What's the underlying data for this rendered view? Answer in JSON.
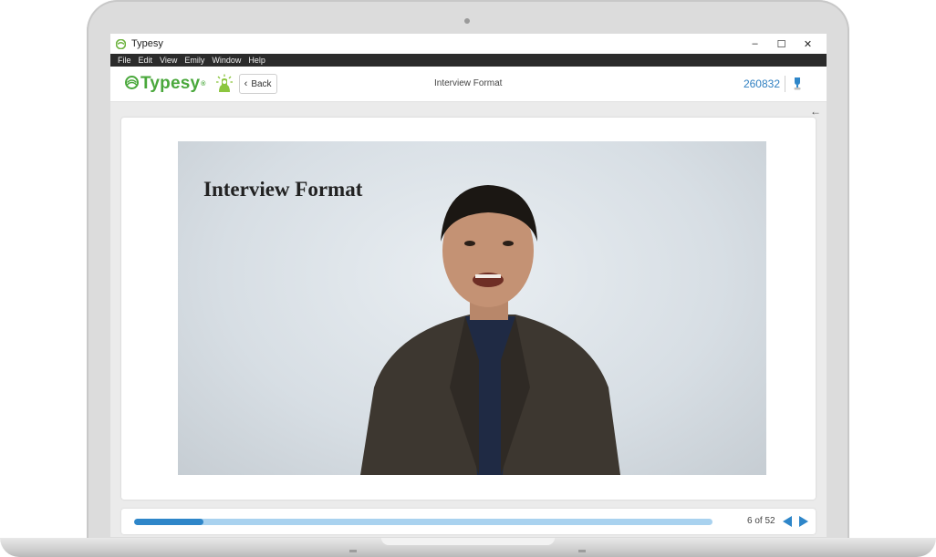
{
  "window": {
    "title": "Typesy",
    "controls": {
      "minimize": "–",
      "maximize": "☐",
      "close": "✕"
    }
  },
  "menubar": [
    "File",
    "Edit",
    "View",
    "Emily",
    "Window",
    "Help"
  ],
  "header": {
    "brand": "Typesy",
    "brand_mark": "®",
    "back_label": "Back",
    "title": "Interview Format",
    "user_id": "260832"
  },
  "video": {
    "caption": "Interview Format"
  },
  "footer": {
    "progress": 0.12,
    "page_count": "6 of 52"
  },
  "colors": {
    "brand_green": "#4aa83c",
    "accent_blue": "#2e86c9",
    "progress_track": "#a9d2ef",
    "menubar_bg": "#2b2b2b"
  },
  "icons": {
    "collapse": "arrow-left-icon",
    "ideas": "lightbulb-icon",
    "trophy": "trophy-icon"
  }
}
